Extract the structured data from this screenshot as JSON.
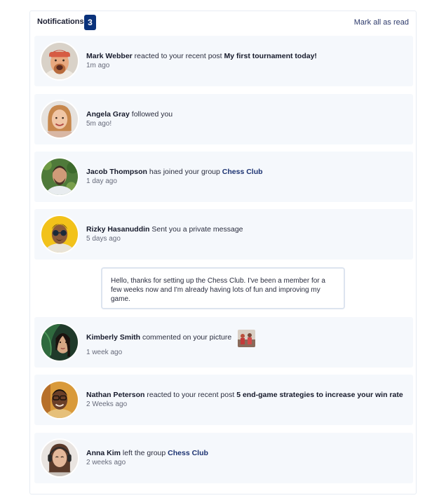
{
  "header": {
    "title": "Notifications",
    "count": "3",
    "mark_all_label": "Mark all as read"
  },
  "notifications": [
    {
      "name": "Mark Webber",
      "action": " reacted to your recent post ",
      "target": "My first tournament today!",
      "time": "1m ago",
      "avatar_icon": "avatar-mark-webber"
    },
    {
      "name": "Angela Gray",
      "action": " followed you",
      "target": "",
      "time": "5m ago!",
      "avatar_icon": "avatar-angela-gray"
    },
    {
      "name": "Jacob Thompson",
      "action": " has joined your group ",
      "target": "Chess Club",
      "time": "1 day ago",
      "avatar_icon": "avatar-jacob-thompson"
    },
    {
      "name": "Rizky Hasanuddin",
      "action": " Sent you a private message",
      "target": "",
      "time": "5 days ago",
      "avatar_icon": "avatar-rizky-hasanuddin"
    },
    {
      "name": "Kimberly Smith",
      "action": " commented on your picture",
      "target": "",
      "time": "1 week ago",
      "avatar_icon": "avatar-kimberly-smith"
    },
    {
      "name": "Nathan Peterson",
      "action": " reacted to your recent post ",
      "target": "5 end-game strategies to increase your win rate",
      "time": "2 Weeks ago",
      "avatar_icon": "avatar-nathan-peterson"
    },
    {
      "name": "Anna Kim",
      "action": " left the group ",
      "target": "Chess Club",
      "time": "2 weeks ago",
      "avatar_icon": "avatar-anna-kim"
    }
  ],
  "private_message": "Hello, thanks for setting up the Chess Club. I've been a member for a few weeks now and I'm already having lots of fun and improving my game.",
  "colors": {
    "badge": "#0a327b",
    "item_bg": "#f5f8fc",
    "link": "#1c3372"
  }
}
